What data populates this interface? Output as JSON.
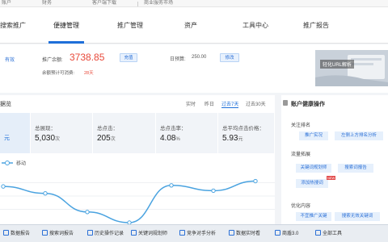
{
  "topbar": {
    "account": "账户",
    "finance": "财务",
    "customer_service": "客户端下载",
    "service_market": "商业服务市场"
  },
  "nav": {
    "left_partial": "搜索推广",
    "items": [
      "便捷管理",
      "推广管理",
      "资产",
      "工具中心",
      "推广报告"
    ],
    "active_index": 0
  },
  "info": {
    "left_link": "有效",
    "balance_label": "推广余额:",
    "balance_value": "3738.85",
    "recharge_label": "充值",
    "days_label": "余额预计可消费:",
    "days_value": "28天",
    "budget_label": "日预算:",
    "budget_value": "250.00",
    "modify_label": "修改",
    "promo_caption": "轻化URL解析"
  },
  "data_card": {
    "title": "据览",
    "ranges": [
      "实时",
      "昨日",
      "过去7天",
      "过去30天"
    ],
    "active_range": 2
  },
  "stats": [
    {
      "title": "",
      "value": "元",
      "unit": ""
    },
    {
      "title": "总展现：",
      "value": "5,030",
      "unit": "次"
    },
    {
      "title": "总点击：",
      "value": "205",
      "unit": "次"
    },
    {
      "title": "总点击率：",
      "value": "4.08",
      "unit": "%"
    },
    {
      "title": "总平均点击价格：",
      "value": "5.93",
      "unit": "元"
    }
  ],
  "chart_data": {
    "type": "line",
    "series": [
      {
        "name": "移动",
        "values": [
          68,
          55,
          20,
          0,
          70,
          60,
          78
        ]
      }
    ],
    "ylim": [
      0,
      100
    ],
    "legend": "top-left",
    "grid": true
  },
  "chart_legend": {
    "label": "移动",
    "color": "#4aa3e0"
  },
  "panel": {
    "title": "账户健康操作",
    "sections": [
      {
        "title": "关注排名",
        "chips": [
          "推广实况",
          "左侧上方排名分析"
        ]
      },
      {
        "title": "流量拓展",
        "chips": [
          "关键词规划师",
          "搜索词报告",
          "添加热搜词"
        ]
      },
      {
        "title": "优化内容",
        "chips": [
          "不宜推广关键",
          "搜索无效关键词"
        ]
      }
    ],
    "new_tag": "NEW"
  },
  "toolbar": [
    "数据报告",
    "搜索词报告",
    "历史操作记录",
    "关键词规划师",
    "竞争对手分析",
    "数据实时看",
    "商盾3.0",
    "全部工具"
  ],
  "colors": {
    "accent": "#1e6fd9",
    "balance": "#e8493a",
    "line": "#4aa3e0"
  }
}
